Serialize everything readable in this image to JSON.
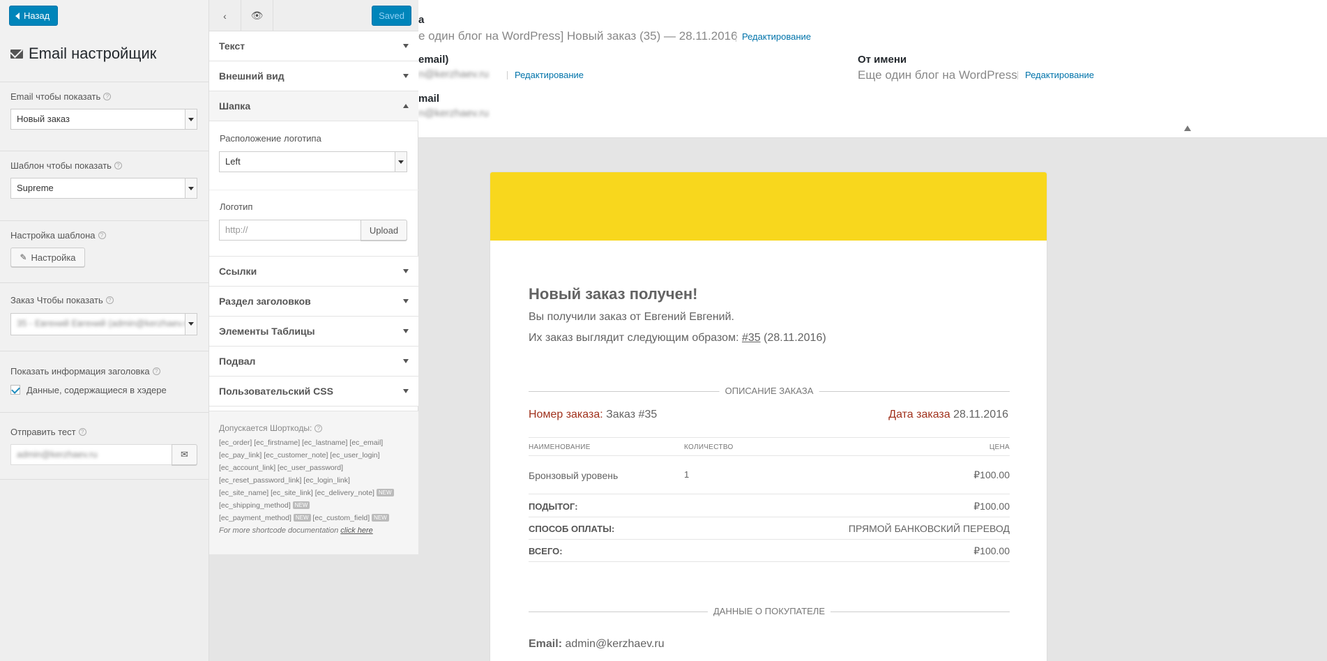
{
  "left": {
    "back_label": "Назад",
    "title": "Email настройщик",
    "email_to_show": {
      "label": "Email чтобы показать",
      "value": "Новый заказ"
    },
    "template_to_show": {
      "label": "Шаблон чтобы показать",
      "value": "Supreme"
    },
    "template_settings": {
      "label": "Настройка шаблона",
      "button": "Настройка"
    },
    "order_to_show": {
      "label": "Заказ Чтобы показать",
      "value": "35 - Евгений Евгений (admin@kerzhaev.ru)"
    },
    "show_header_info": {
      "label": "Показать информация заголовка",
      "checkbox_label": "Данные, содержащиеся в хэдере",
      "checked": true
    },
    "send_test": {
      "label": "Отправить тест",
      "value": "admin@kerzhaev.ru"
    }
  },
  "mid": {
    "saved_label": "Saved",
    "sections": [
      {
        "label": "Текст"
      },
      {
        "label": "Внешний вид"
      },
      {
        "label": "Шапка"
      },
      {
        "label": "Ссылки"
      },
      {
        "label": "Раздел заголовков"
      },
      {
        "label": "Элементы Таблицы"
      },
      {
        "label": "Подвал"
      },
      {
        "label": "Пользовательский CSS"
      }
    ],
    "logo_position": {
      "label": "Расположение логотипа",
      "value": "Left"
    },
    "logo": {
      "label": "Логотип",
      "placeholder": "http://",
      "upload": "Upload"
    },
    "shortcodes": {
      "title": "Допускается Шорткоды:",
      "line1": "[ec_order] [ec_firstname] [ec_lastname] [ec_email]",
      "line2": "[ec_pay_link] [ec_customer_note] [ec_user_login]",
      "line3": "[ec_account_link] [ec_user_password]",
      "line4": "[ec_reset_password_link] [ec_login_link]",
      "line5": "[ec_site_name] [ec_site_link] [ec_delivery_note]",
      "line6": "[ec_shipping_method]",
      "line7a": "[ec_payment_method]",
      "line7b": "[ec_custom_field]",
      "new_badge": "NEW",
      "doc_text": "For more shortcode documentation",
      "doc_link": "click here"
    }
  },
  "header": {
    "subject_label": "а",
    "subject": "е один блог на WordPress] Новый заказ (35) — 28.11.2016",
    "edit": "Редактирование",
    "from_email_label": "email)",
    "from_email_value": "n@kerzhaev.ru",
    "from_name_label": "От имени",
    "from_name_value": "Еще один блог на WordPress",
    "email_label": "mail",
    "email_value": "n@kerzhaev.ru"
  },
  "email": {
    "heading": "Новый заказ получен!",
    "intro": "Вы получили заказ от Евгений Евгений.",
    "order_text": "Их заказ выглядит следующим образом:",
    "order_link": "#35",
    "order_date_paren": "(28.11.2016)",
    "order_section_title": "ОПИСАНИЕ ЗАКАЗА",
    "order_number_label": "Номер заказа:",
    "order_number_value": "Заказ #35",
    "order_date_label": "Дата заказа",
    "order_date_value": "28.11.2016",
    "col_name": "НАИМЕНОВАНИЕ",
    "col_qty": "КОЛИЧЕСТВО",
    "col_price": "ЦЕНА",
    "item_name": "Бронзовый уровень",
    "item_qty": "1",
    "item_price": "₽100.00",
    "subtotal_label": "ПОДЫТОГ:",
    "subtotal_value": "₽100.00",
    "payment_label": "СПОСОБ ОПЛАТЫ:",
    "payment_value": "ПРЯМОЙ БАНКОВСКИЙ ПЕРЕВОД",
    "total_label": "ВСЕГО:",
    "total_value": "₽100.00",
    "customer_section_title": "ДАННЫЕ О ПОКУПАТЕЛЕ",
    "email_label": "Email:",
    "email_value": "admin@kerzhaev.ru"
  },
  "colors": {
    "accent": "#0085ba",
    "banner": "#f8d71d",
    "order_label": "#a0311c",
    "link": "#0073aa"
  }
}
